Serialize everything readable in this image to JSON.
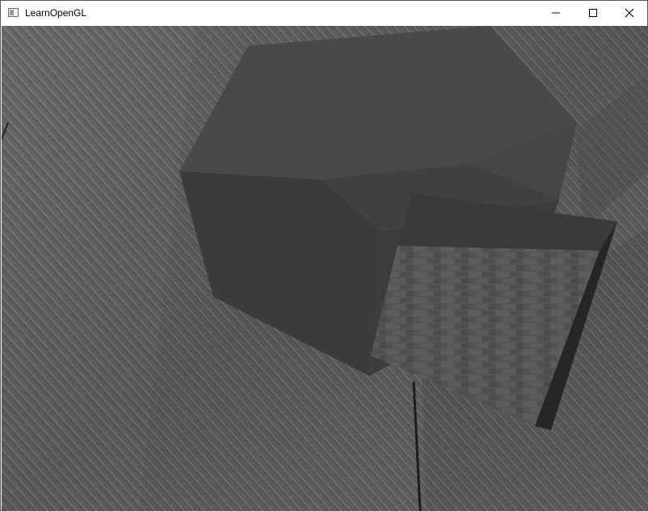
{
  "window": {
    "title": "LearnOpenGL",
    "icon": "app-window-icon",
    "controls": {
      "minimize": "minimize-icon",
      "maximize": "maximize-icon",
      "close": "close-icon"
    }
  },
  "scene": {
    "description_icon": "opengl-render-canvas",
    "colors": {
      "floor_base": "#5d5f60",
      "stripe_a": "#7c7f72",
      "stripe_b": "#6f6876",
      "large_cube_top": "#464848",
      "large_cube_side": "#3c3e3e",
      "small_cube_face": "#585858",
      "small_cube_top": "#3a3a3a",
      "small_cube_side": "#262626"
    }
  }
}
